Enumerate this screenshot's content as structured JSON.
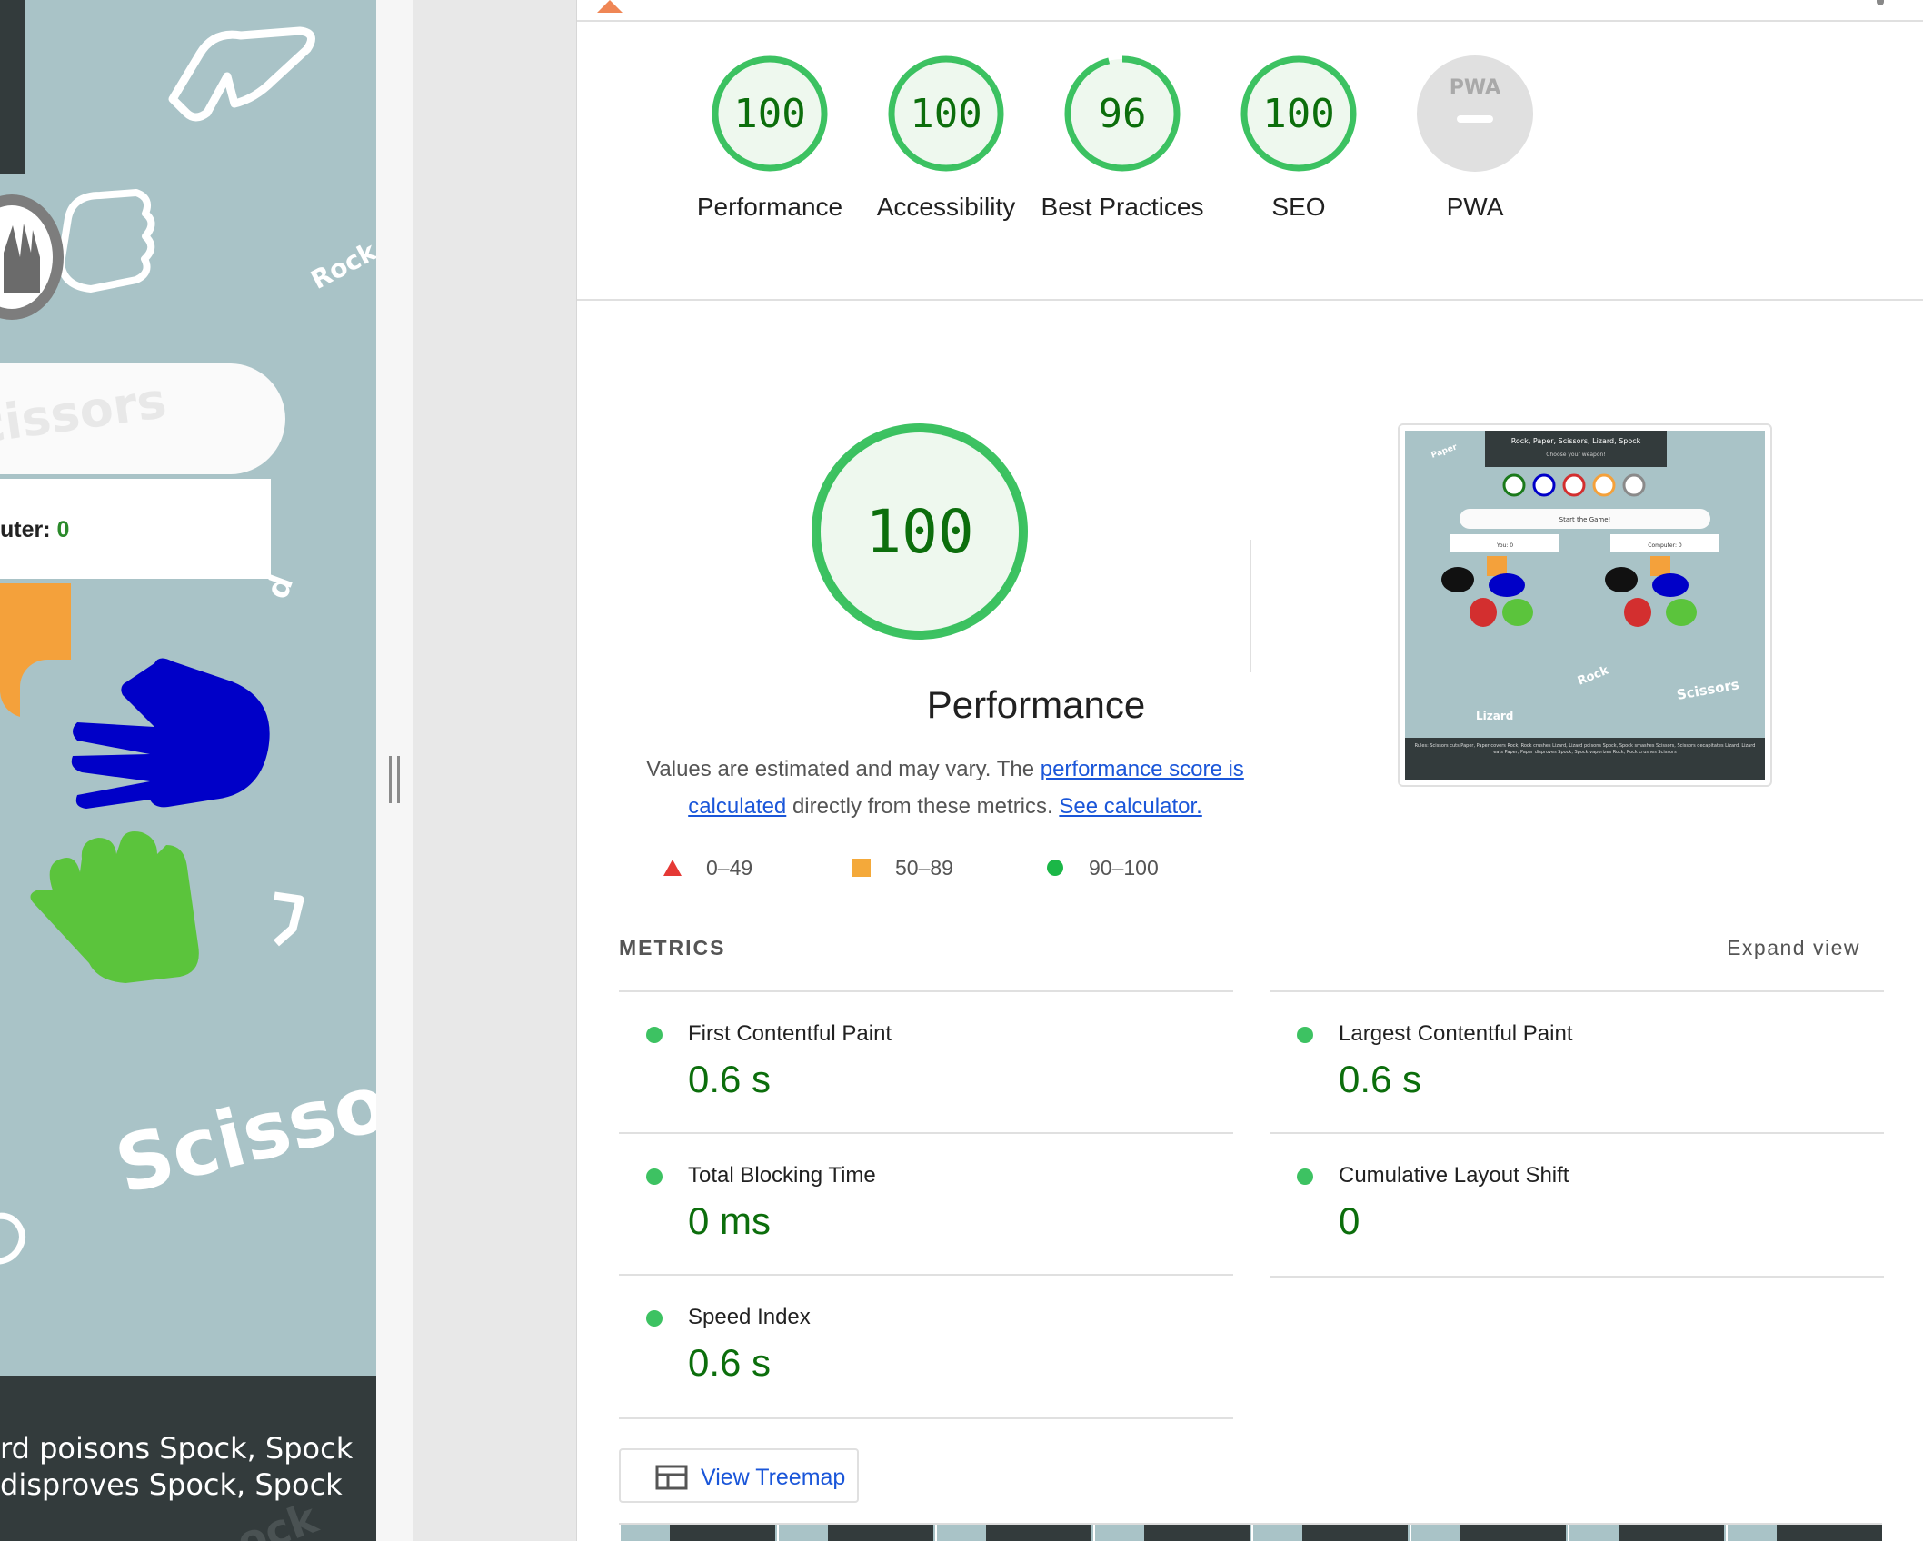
{
  "preview": {
    "button_text": "Scissors",
    "score_label": "uter:",
    "score_value": "0",
    "watermarks": {
      "rock": "Rock",
      "scissors": "Scisso",
      "rock_bottom": "ock",
      "d": "d"
    },
    "footer_line1": "rd poisons Spock, Spock",
    "footer_line2": "disproves Spock, Spock"
  },
  "scores": [
    {
      "value": "100",
      "label": "Performance",
      "score": 1.0
    },
    {
      "value": "100",
      "label": "Accessibility",
      "score": 1.0
    },
    {
      "value": "96",
      "label": "Best Practices",
      "score": 0.96
    },
    {
      "value": "100",
      "label": "SEO",
      "score": 1.0
    },
    {
      "value": "PWA",
      "label": "PWA",
      "score": null
    }
  ],
  "performance": {
    "score": "100",
    "title": "Performance",
    "desc_prefix": "Values are estimated and may vary. The ",
    "desc_link1": "performance score is calculated",
    "desc_middle": " directly from these metrics. ",
    "desc_link2": "See calculator."
  },
  "scale": [
    {
      "range": "0–49",
      "color": "#e53935",
      "shape": "triangle"
    },
    {
      "range": "50–89",
      "color": "#f4a93a",
      "shape": "square"
    },
    {
      "range": "90–100",
      "color": "#1bb747",
      "shape": "circle"
    }
  ],
  "metrics": {
    "heading": "METRICS",
    "expand": "Expand view",
    "items": [
      {
        "name": "First Contentful Paint",
        "value": "0.6 s"
      },
      {
        "name": "Largest Contentful Paint",
        "value": "0.6 s"
      },
      {
        "name": "Total Blocking Time",
        "value": "0 ms"
      },
      {
        "name": "Cumulative Layout Shift",
        "value": "0"
      },
      {
        "name": "Speed Index",
        "value": "0.6 s"
      }
    ]
  },
  "treemap_button": "View Treemap",
  "screenshot": {
    "title": "Rock, Paper, Scissors, Lizard, Spock",
    "subtitle": "Choose your weapon!",
    "start": "Start the Game!",
    "you": "You: 0",
    "computer": "Computer: 0",
    "rules": "Rules: Scissors cuts Paper, Paper covers Rock, Rock crushes Lizard, Lizard poisons Spock, Spock smashes Scissors, Scissors decapitates Lizard, Lizard eats Paper, Paper disproves Spock, Spock vaporizes Rock, Rock crushes Scissors",
    "watermarks": [
      "Paper",
      "Rock",
      "Scissors",
      "Lizard"
    ]
  },
  "colors": {
    "pass": "#0c6e0c",
    "pass_ring": "#1bb747",
    "link": "#1a56d9",
    "orange": "#f4a93a",
    "blue": "#0000c8",
    "green": "#5bc43c"
  }
}
